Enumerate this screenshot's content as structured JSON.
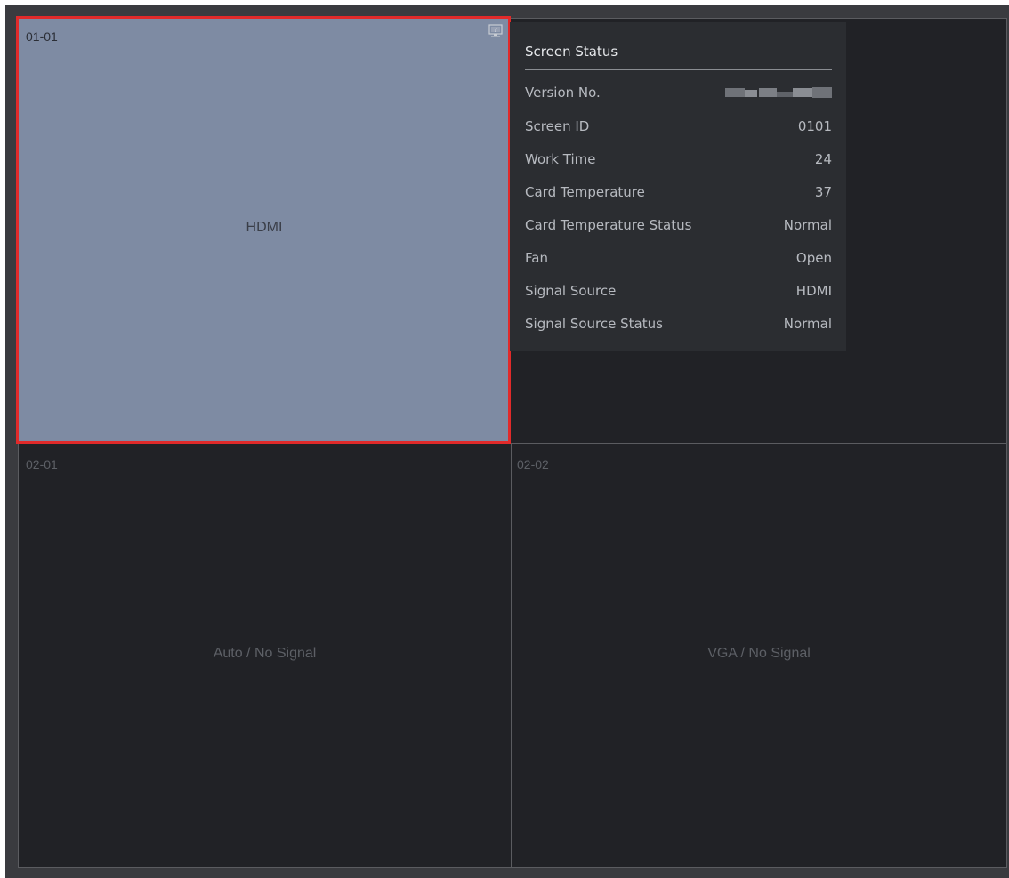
{
  "screens": {
    "s0101": {
      "id": "01-01",
      "source": "HDMI"
    },
    "s0201": {
      "id": "02-01",
      "source": "Auto / No Signal"
    },
    "s0202": {
      "id": "02-02",
      "source": "VGA / No Signal"
    }
  },
  "tooltip": {
    "title": "Screen Status",
    "rows": [
      {
        "label": "Version No.",
        "value": ""
      },
      {
        "label": "Screen ID",
        "value": "0101"
      },
      {
        "label": "Work Time",
        "value": "24"
      },
      {
        "label": "Card Temperature",
        "value": "37"
      },
      {
        "label": "Card Temperature Status",
        "value": "Normal"
      },
      {
        "label": "Fan",
        "value": "Open"
      },
      {
        "label": "Signal Source",
        "value": "HDMI"
      },
      {
        "label": "Signal Source Status",
        "value": "Normal"
      }
    ]
  },
  "icons": {
    "status": "monitor-status-icon"
  },
  "colors": {
    "selected_fill": "#7e8ba3",
    "selected_border": "#e12a2a",
    "wall_bg": "#212226"
  }
}
